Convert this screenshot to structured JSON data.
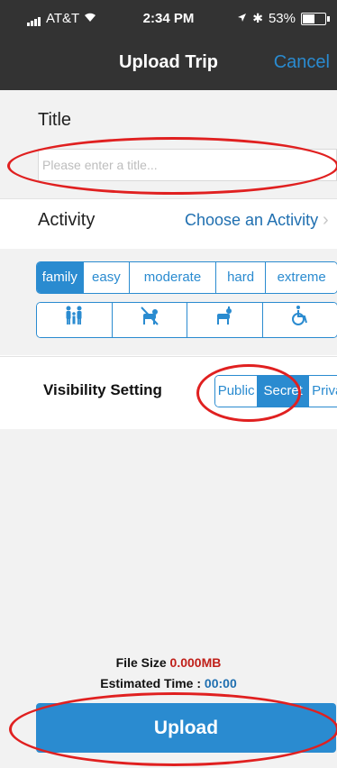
{
  "status_bar": {
    "carrier": "AT&T",
    "time": "2:34 PM",
    "battery": "53%"
  },
  "nav": {
    "title": "Upload Trip",
    "cancel_label": "Cancel"
  },
  "title_section": {
    "label": "Title",
    "placeholder": "Please enter a title..."
  },
  "activity": {
    "label": "Activity",
    "value": "Choose an Activity",
    "chevron": "›"
  },
  "difficulty": {
    "options": [
      "family",
      "easy",
      "moderate",
      "hard",
      "extreme"
    ],
    "selected": "family"
  },
  "accessibility_icons": [
    "family-icon",
    "no-dogs-icon",
    "dogs-allowed-icon",
    "wheelchair-icon"
  ],
  "visibility": {
    "label": "Visibility Setting",
    "options": [
      "Public",
      "Secret",
      "Private"
    ],
    "selected": "Secret"
  },
  "file_info": {
    "file_size_label": "File Size",
    "file_size_value": "0.000MB",
    "estimated_time_label": "Estimated Time :",
    "estimated_time_value": "00:00"
  },
  "upload_label": "Upload",
  "colors": {
    "accent": "#2a8bd0",
    "navbar": "#333333",
    "background": "#f2f2f2",
    "annotation": "#e02020",
    "file_size_value": "#c0201a"
  }
}
